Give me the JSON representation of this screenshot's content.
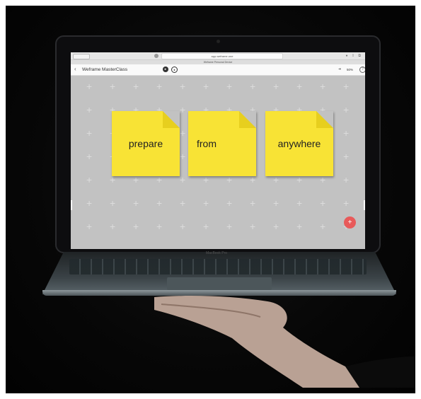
{
  "browser": {
    "url": "app.weframe.one",
    "tab_title": "Weframe Personal Device"
  },
  "app": {
    "back_label": "‹",
    "title": "Weframe MasterClass",
    "zoom": "50%",
    "share_icon": "share-icon",
    "help_label": "?"
  },
  "notes": [
    {
      "label": "prepare"
    },
    {
      "label": "from"
    },
    {
      "label": "anywhere"
    }
  ],
  "fab": {
    "label": "+"
  },
  "laptop": {
    "brand": "MacBook Pro"
  },
  "colors": {
    "note": "#f8e335",
    "canvas": "#c2c2c2",
    "fab": "#e85a5a",
    "background": "#070707"
  }
}
